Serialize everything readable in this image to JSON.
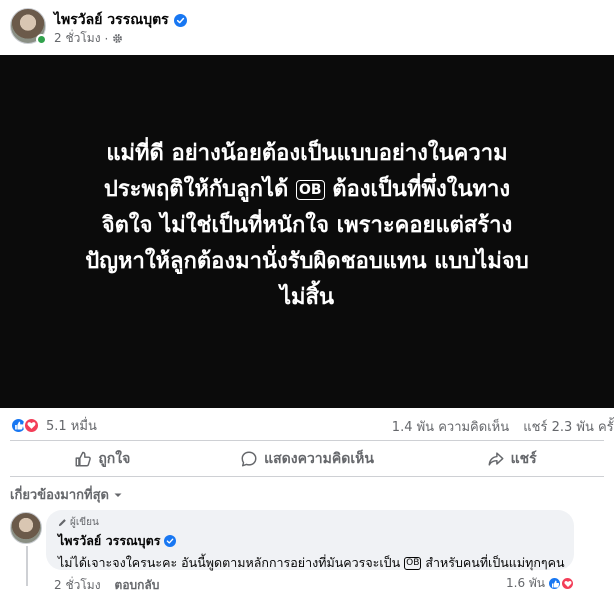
{
  "post": {
    "author": "ไพรวัลย์ วรรณบุตร",
    "time": "2 ชั่วโมง",
    "separator": "·",
    "content_lines": [
      "แม่ที่ดี อย่างน้อยต้องเป็นแบบอย่างในความ",
      "ประพฤติให้กับลูกได้",
      "ต้องเป็นที่พึ่งในทาง",
      "จิตใจ ไม่ใช่เป็นที่หนักใจ เพราะคอยแต่สร้าง",
      "ปัญหาให้ลูกต้องมานั่งรับผิดชอบแทน แบบไม่จบ",
      "ไม่สิ้น"
    ],
    "ob_label": "OB",
    "background_color": "#0b0b0b"
  },
  "stats": {
    "reactions": "5.1 หมื่น",
    "comments": "1.4 พัน ความคิดเห็น",
    "shares": "แชร์ 2.3 พัน ครั้ง"
  },
  "actions": {
    "like": "ถูกใจ",
    "comment": "แสดงความคิดเห็น",
    "share": "แชร์"
  },
  "sort_label": "เกี่ยวข้องมากที่สุด",
  "comment": {
    "badge": "ผู้เขียน",
    "author": "ไพรวัลย์ วรรณบุตร",
    "text_before": "ไม่ได้เจาะจงใครนะคะ อันนี้พูดตามหลักการอย่างที่มันควรจะเป็น",
    "text_after": "สำหรับคนที่เป็นแม่ทุกๆคน",
    "ob_label": "OB",
    "time": "2 ชั่วโมง",
    "reply": "ตอบกลับ",
    "reactions": "1.6 พัน"
  },
  "colors": {
    "accent": "#1877f2",
    "love": "#f33e58",
    "online": "#31a24c",
    "muted_text": "#65676b"
  }
}
